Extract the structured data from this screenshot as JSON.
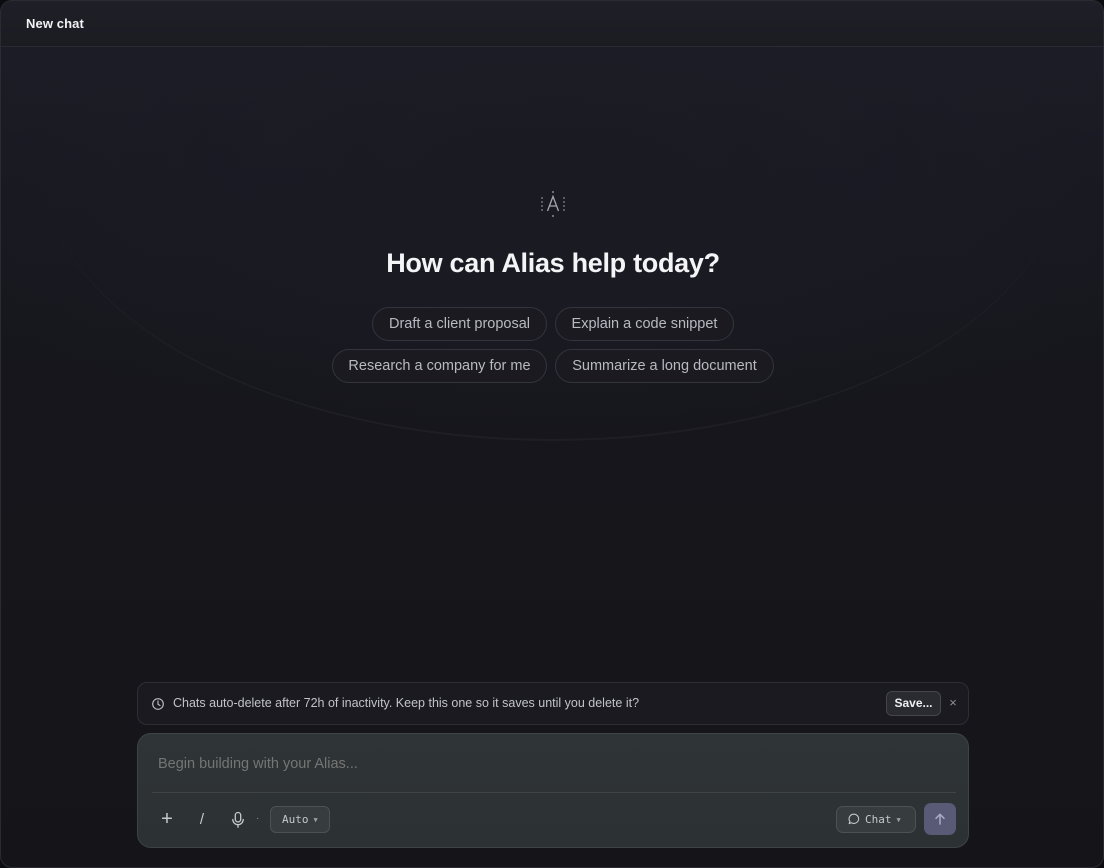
{
  "topbar": {
    "title": "New chat"
  },
  "hero": {
    "logo_icon": "alias-logo-icon",
    "headline": "How can Alias help today?",
    "suggestions": [
      "Draft a client proposal",
      "Explain a code snippet",
      "Research a company for me",
      "Summarize a long document"
    ]
  },
  "notice": {
    "icon": "clock-icon",
    "message": "Chats auto-delete after 72h of inactivity. Keep this one so it saves until you delete it?",
    "save_label": "Save...",
    "close_label": "×"
  },
  "composer": {
    "placeholder": "Begin building with your Alias...",
    "plus_label": "+",
    "slash_label": "/",
    "mic_dropdown_label": "·",
    "model_selector": "Auto",
    "mode_selector": "Chat",
    "send_icon": "arrow-up-icon"
  },
  "colors": {
    "background": "#16161c",
    "chip_border": "#34343d",
    "composer_bg": "#2f3436",
    "send_button": "#585a76"
  }
}
